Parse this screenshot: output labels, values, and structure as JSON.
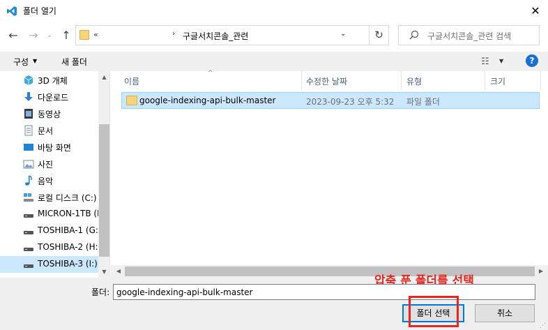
{
  "window": {
    "title": "폴더 열기",
    "close_glyph": "✕"
  },
  "address": {
    "overflow": "«",
    "separator": "›",
    "path": "구글서치콘솔_관련",
    "dropdown": "⌄",
    "refresh_glyph": "↻"
  },
  "search": {
    "placeholder": "구글서치콘솔_관련 검색"
  },
  "nav_buttons": {
    "back": "←",
    "forward": "→",
    "recent": "⌄",
    "up": "↑"
  },
  "toolbar": {
    "organize": "구성",
    "organize_caret": "▼",
    "new_folder": "새 폴더",
    "view_glyph": "☷",
    "view_caret": "▼",
    "help": "?"
  },
  "sidebar": {
    "items": [
      {
        "label": "3D 개체",
        "icon": "3d-objects-icon",
        "color": "#3fa9d9"
      },
      {
        "label": "다운로드",
        "icon": "download-icon",
        "color": "#2f7fd8"
      },
      {
        "label": "동영상",
        "icon": "videos-icon",
        "color": "#3a3a3a"
      },
      {
        "label": "문서",
        "icon": "documents-icon",
        "color": "#6e8aa6"
      },
      {
        "label": "바탕 화면",
        "icon": "desktop-icon",
        "color": "#1e84d6"
      },
      {
        "label": "사진",
        "icon": "pictures-icon",
        "color": "#6e8aa6"
      },
      {
        "label": "음악",
        "icon": "music-icon",
        "color": "#1e84d6"
      },
      {
        "label": "로컬 디스크 (C:)",
        "icon": "local-disk-icon",
        "color": "#4a9bd8"
      },
      {
        "label": "MICRON-1TB (F",
        "icon": "drive-icon",
        "color": "#555555"
      },
      {
        "label": "TOSHIBA-1 (G:)",
        "icon": "drive-icon",
        "color": "#555555"
      },
      {
        "label": "TOSHIBA-2 (H:)",
        "icon": "drive-icon",
        "color": "#555555"
      },
      {
        "label": "TOSHIBA-3 (I:)",
        "icon": "drive-icon",
        "color": "#555555",
        "selected": true
      }
    ],
    "scroll_up": "▲",
    "scroll_down": "▼"
  },
  "columns": {
    "name": "이름",
    "modified": "수정한 날짜",
    "type": "유형",
    "size": "크기",
    "sort_arrow": "^"
  },
  "files": [
    {
      "name": "google-indexing-api-bulk-master",
      "modified": "2023-09-23 오후 5:32",
      "type": "파일 폴더",
      "size": ""
    }
  ],
  "hscroll": {
    "left": "◀",
    "right": "▶"
  },
  "bottom": {
    "folder_label": "폴더:",
    "folder_value": "google-indexing-api-bulk-master",
    "select_button": "폴더 선택",
    "cancel_button": "취소",
    "annotation": "압축 푼 폴더를 선택",
    "resize_glyph": "⋰"
  },
  "colors": {
    "accent": "#0078d7",
    "selection": "#cce8ff",
    "annotation": "#e8261f",
    "folder": "#f6d47a"
  }
}
